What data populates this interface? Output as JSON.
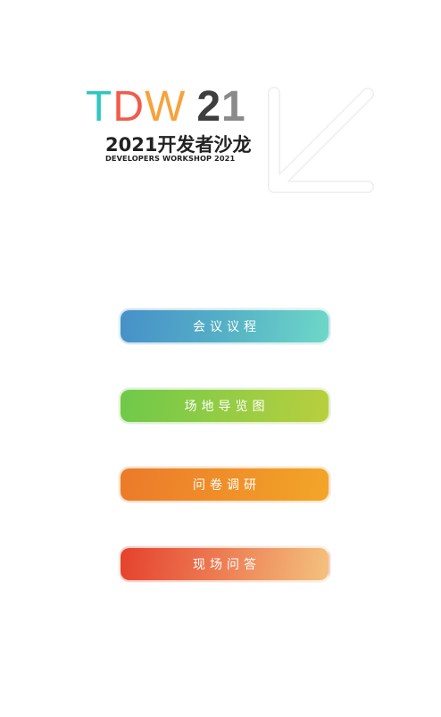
{
  "logo": {
    "t": "T",
    "d": "D",
    "w": "W",
    "num_2": "2",
    "num_1": "1",
    "title_cn": "2021开发者沙龙",
    "subtitle_en": "DEVELOPERS WORKSHOP 2021",
    "colors": {
      "t": "#2ec6c2",
      "d": "#f15c4a",
      "w": "#f7a23a",
      "num": "#3e3e3e"
    }
  },
  "menu": [
    {
      "label": "会议议程",
      "colors": [
        "#4690c9",
        "#6ed8c8"
      ]
    },
    {
      "label": "场地导览图",
      "colors": [
        "#6ec94a",
        "#b9cf3e"
      ]
    },
    {
      "label": "问卷调研",
      "colors": [
        "#ec7a2a",
        "#f2a628"
      ]
    },
    {
      "label": "现场问答",
      "colors": [
        "#e5412d",
        "#f4c27e"
      ]
    }
  ]
}
